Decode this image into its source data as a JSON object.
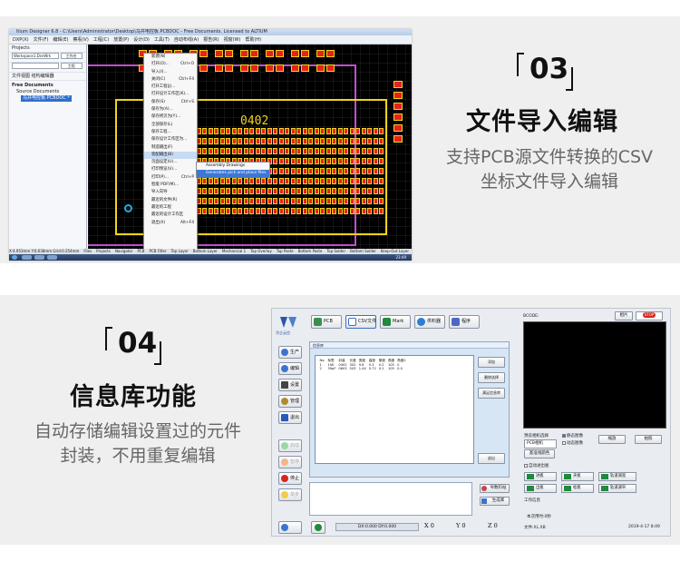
{
  "section03": {
    "number": "03",
    "title": "文件导入编辑",
    "desc_line1": "支持PCB源文件转换的CSV",
    "desc_line2": "坐标文件导入编辑"
  },
  "section04": {
    "number": "04",
    "title": "信息库功能",
    "desc_line1": "自动存储编辑设置过的元件",
    "desc_line2": "封装，不用重复编辑"
  },
  "altium": {
    "window_title": "ltium Designer 6.8 - C:\\Users\\Administrator\\Desktop\\马井电控板.PCBDOC - Free Documents. Licensed to ALTIUM",
    "menu": [
      "DXP(X)",
      "文件(F)",
      "编辑(E)",
      "察看(V)",
      "工程(C)",
      "放置(P)",
      "设计(D)",
      "工具(T)",
      "自动布线(A)",
      "报告(R)",
      "视窗(W)",
      "帮助(H)"
    ],
    "panel_title": "Projects",
    "workspace": "Workspace1.DsnWrk",
    "workspace_btn": "工作台",
    "project_btn": "工程",
    "panel_tabs": "文件视图  结构编辑器",
    "tree_root": "Free Documents",
    "tree_child": "Source Documents",
    "tree_file": "马井电控板.PCBDOC *",
    "board_label": "0402",
    "file_menu": [
      {
        "label": "新建(N)",
        "key": ""
      },
      {
        "label": "打开(O)...",
        "key": "Ctrl+O"
      },
      {
        "label": "导入(I)...",
        "key": ""
      },
      {
        "label": "关闭(C)",
        "key": "Ctrl+F4"
      },
      {
        "label": "打开工程(J)...",
        "key": ""
      },
      {
        "label": "打开设计工作区(K)...",
        "key": ""
      },
      {
        "label": "保存(S)",
        "key": "Ctrl+S"
      },
      {
        "label": "保存为(A)...",
        "key": ""
      },
      {
        "label": "保存拷贝为(Y)...",
        "key": ""
      },
      {
        "label": "全部保存(L)",
        "key": ""
      },
      {
        "label": "保存工程...",
        "key": ""
      },
      {
        "label": "保存设计工作区为...",
        "key": ""
      },
      {
        "label": "制造输出(F)",
        "key": ""
      },
      {
        "label": "装配输出(B)",
        "key": ""
      },
      {
        "label": "页面设定(U)...",
        "key": ""
      },
      {
        "label": "打印预览(V)...",
        "key": ""
      },
      {
        "label": "打印(P)...",
        "key": "Ctrl+P"
      },
      {
        "label": "智能 PDF(M)...",
        "key": ""
      },
      {
        "label": "导入向导",
        "key": ""
      },
      {
        "label": "最近的文件(R)",
        "key": ""
      },
      {
        "label": "最近的工程",
        "key": ""
      },
      {
        "label": "最近的设计工作区",
        "key": ""
      },
      {
        "label": "退出(X)",
        "key": "Alt+F4"
      }
    ],
    "submenu": [
      "Assembly Drawings",
      "Generates pick and place files"
    ],
    "bottom_tabs": [
      "Files",
      "Projects",
      "Navigator",
      "PCB",
      "PCB Filter",
      "Top Layer",
      "Bottom Layer",
      "Mechanical 1",
      "Top Overlay",
      "Top Paste",
      "Bottom Paste",
      "Top Solder",
      "Bottom Solder",
      "Keep-Out Layer",
      "Multi-Layer"
    ],
    "status_coords": "X:4.953mm Y:0.638mm    Grid:0.254mm",
    "clock": "23:49"
  },
  "software": {
    "logo_text": "华企云信",
    "top_buttons": [
      "PCB",
      "CSV文件",
      "Mark",
      "供料器",
      "程序"
    ],
    "side_buttons": [
      "生产",
      "编辑",
      "设置",
      "管理",
      "退出"
    ],
    "side_buttons_lower": [
      "启动",
      "暂停",
      "停止",
      "单步"
    ],
    "info_panel_title": "信息库",
    "table_headers": [
      "No.",
      "标签",
      "封装",
      "长度",
      "宽度",
      "高度",
      "厚度",
      "角度",
      "角度2"
    ],
    "table_rows": [
      [
        "1",
        "10K",
        "0402",
        "302",
        "9.6",
        "0.3",
        "0.2",
        "105",
        "0"
      ],
      [
        "2",
        "39pF",
        "0603",
        "503",
        "1.44",
        "0.72",
        "0.2",
        "105",
        "0.0"
      ]
    ],
    "panel_buttons": [
      "添加",
      "删除选择",
      "满足信息库"
    ],
    "exit_button": "退出",
    "load_button": "导数料站",
    "save_button": "生成库",
    "coord_label": "DX:0.000 DY:0.000",
    "axis_x": "X 0",
    "axis_y": "Y 0",
    "axis_z": "Z 0",
    "camera_label": "BCODE:",
    "camera_btn1": "相片",
    "camera_btn2": "STOP",
    "camera_sel_label": "预览相机选择",
    "camera_sel_value": "PCB相机",
    "static_image": "静态图像",
    "dynamic_image": "动态图像",
    "zoom_btn": "缩放",
    "photo_btn": "拍照",
    "base_color": "基准线颜色",
    "auto_exit": "自动进出板",
    "dir_buttons": [
      "进板",
      "夹板",
      "轨道调宽",
      "出板",
      "松板",
      "轨道调窄"
    ],
    "work_info": "工作信息",
    "runtime": "本次用时:0秒",
    "file_name": "文件:XL.XB",
    "date": "2019-4-17 8:49"
  }
}
